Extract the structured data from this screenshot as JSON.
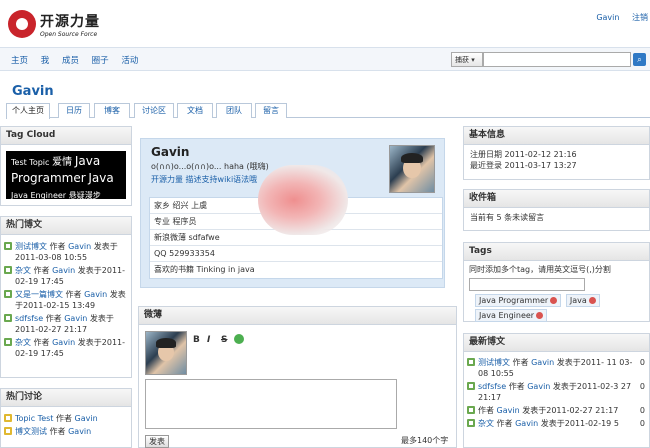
{
  "brand": {
    "name_cn": "开源力量",
    "name_en": "Open Source Force"
  },
  "top_links": [
    "Gavin",
    "注销"
  ],
  "nav": [
    "主页",
    "我",
    "成员",
    "圈子",
    "活动"
  ],
  "search": {
    "select_label": "捕获 ▾",
    "value": ""
  },
  "page_title": "Gavin",
  "tabs": [
    "个人主页",
    "日历",
    "博客",
    "讨论区",
    "文档",
    "团队",
    "留言"
  ],
  "tag_cloud": {
    "title": "Tag Cloud",
    "words": [
      "Test Topic",
      "爱情",
      "Java",
      "Programmer",
      "Java",
      "Java Engineer",
      "悬疑漫步"
    ]
  },
  "hot_blogs": {
    "title": "热门博文",
    "items": [
      {
        "title": "测试博文",
        "by": "作者",
        "author": "Gavin",
        "pub": "发表于2011-03-08 10:55"
      },
      {
        "title": "杂文",
        "by": "作者",
        "author": "Gavin",
        "pub": "发表于2011-02-19 17:45"
      },
      {
        "title": "又是一篇博文",
        "by": "作者",
        "author": "Gavin",
        "pub": "发表于2011-02-15 13:49"
      },
      {
        "title": "sdfsfse",
        "by": "作者",
        "author": "Gavin",
        "pub": "发表于2011-02-27 21:17"
      },
      {
        "title": "杂文",
        "by": "作者",
        "author": "Gavin",
        "pub": "发表于2011-02-19 17:45"
      }
    ]
  },
  "hot_discussions": {
    "title": "热门讨论",
    "items": [
      {
        "title": "Topic Test",
        "by": "作者",
        "author": "Gavin"
      },
      {
        "title": "博文测试",
        "by": "作者",
        "author": "Gavin"
      }
    ]
  },
  "profile": {
    "name": "Gavin",
    "motto": "o(∩∩)o...o(∩∩)o... haha (哦嗨)",
    "desc": "开源力量 描述支持wiki语法哦",
    "rows": [
      "家乡 绍兴 上虞",
      "专业 程序员",
      "新浪微薄 sdfafwe",
      "QQ 529933354",
      "喜欢的书籍 Tinking in java"
    ]
  },
  "microblog": {
    "title": "微薄",
    "tools": [
      "B",
      "I",
      "S"
    ],
    "post_label": "发表",
    "count_label": "最多140个字"
  },
  "basic_info": {
    "title": "基本信息",
    "registered": "注册日期 2011-02-12 21:16",
    "last_login": "最近登录 2011-03-17 13:27"
  },
  "inbox": {
    "title": "收件箱",
    "text": "当前有 5 条未读留言"
  },
  "tags": {
    "title": "Tags",
    "hint": "同时添加多个tag，请用英文逗号(,)分割",
    "items": [
      "Java Programmer",
      "Java",
      "Java Engineer"
    ]
  },
  "latest_blogs": {
    "title": "最新博文",
    "items": [
      {
        "title": "测试博文",
        "by": "作者",
        "author": "Gavin",
        "pub": "发表于2011- 11",
        "date2": "03-08 10:55"
      },
      {
        "title": "sdfsfse",
        "by": "作者",
        "author": "Gavin",
        "pub": "发表于2011-02-3",
        "date2": "27 21:17"
      },
      {
        "title": "",
        "by": "作者",
        "author": "Gavin",
        "pub": "发表于2011-02-27",
        "date2": "21:17"
      },
      {
        "title": "杂文",
        "by": "作者",
        "author": "Gavin",
        "pub": "发表于2011-02-19 5",
        "date2": ""
      }
    ],
    "counts": [
      "0",
      "0",
      "0",
      "0"
    ]
  }
}
